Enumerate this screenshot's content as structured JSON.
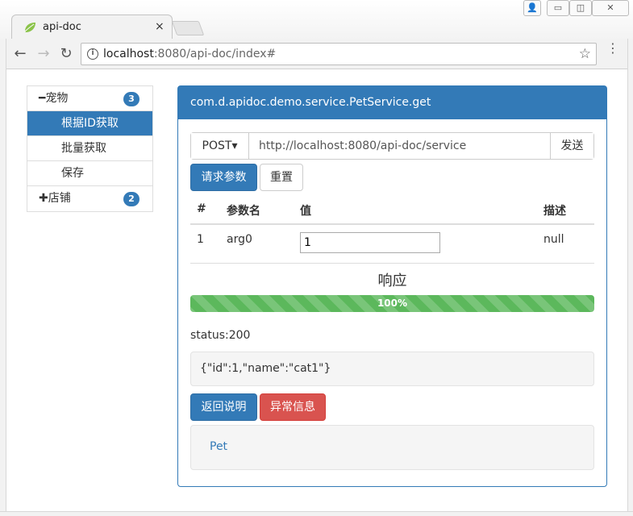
{
  "browser": {
    "tab_title": "api-doc",
    "tab_close": "×",
    "url_host": "localhost",
    "url_rest": ":8080/api-doc/index#",
    "back_glyph": "←",
    "forward_glyph": "→",
    "reload_glyph": "↻",
    "info_glyph": "i",
    "star_glyph": "☆",
    "menu_glyph": "⋮",
    "win_user": "👤",
    "win_min": "▭",
    "win_max": "◫",
    "win_close": "✕"
  },
  "sidebar": {
    "groups": [
      {
        "symbol": "━",
        "label": "宠物",
        "count": "3",
        "items": [
          {
            "label": "根据ID获取",
            "active": true
          },
          {
            "label": "批量获取",
            "active": false
          },
          {
            "label": "保存",
            "active": false
          }
        ]
      },
      {
        "symbol": "✚",
        "label": "店铺",
        "count": "2",
        "items": []
      }
    ]
  },
  "panel": {
    "title": "com.d.apidoc.demo.service.PetService.get",
    "method": "POST",
    "method_caret": "▾",
    "endpoint": "http://localhost:8080/api-doc/service",
    "send_label": "发送",
    "params_button": "请求参数",
    "reset_button": "重置",
    "table": {
      "headers": [
        "#",
        "参数名",
        "值",
        "描述"
      ],
      "rows": [
        {
          "index": "1",
          "name": "arg0",
          "value": "1",
          "description": "null"
        }
      ]
    },
    "response_title": "响应",
    "progress_percent": 100,
    "progress_label": "100%",
    "status": "status:200",
    "response_body": "{\"id\":1,\"name\":\"cat1\"}",
    "return_button": "返回说明",
    "exception_button": "异常信息",
    "return_link": "Pet"
  },
  "colors": {
    "primary": "#337ab7",
    "success": "#5cb85c",
    "danger": "#d9534f"
  }
}
